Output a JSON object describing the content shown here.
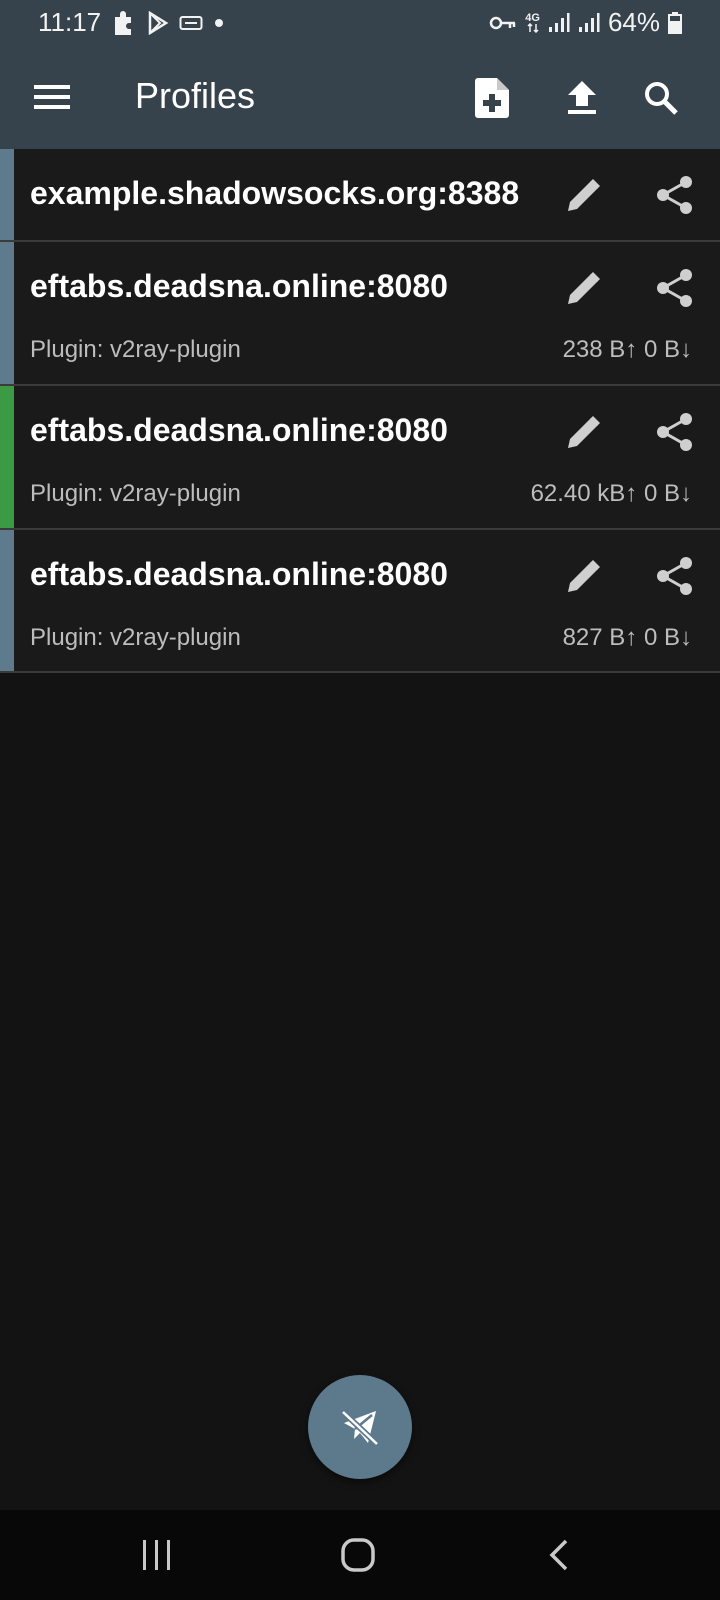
{
  "status_bar": {
    "time": "11:17",
    "network_label_top": "4G",
    "battery": "64%"
  },
  "app_bar": {
    "title": "Profiles",
    "menu_icon": "menu-icon",
    "actions": [
      {
        "name": "add-profile-button",
        "icon": "file-add-icon"
      },
      {
        "name": "import-button",
        "icon": "upload-icon"
      },
      {
        "name": "search-button",
        "icon": "search-icon"
      }
    ]
  },
  "profiles": [
    {
      "name": "example.shadowsocks.org:8388",
      "plugin": "",
      "traffic": "",
      "stripe": "#5e7a8d"
    },
    {
      "name": "eftabs.deadsna.online:8080",
      "plugin": "Plugin: v2ray-plugin",
      "traffic": "238 B↑  0 B↓",
      "stripe": "#5e7a8d"
    },
    {
      "name": "eftabs.deadsna.online:8080",
      "plugin": "Plugin: v2ray-plugin",
      "traffic": "62.40 kB↑  0 B↓",
      "stripe": "#3d9a44"
    },
    {
      "name": "eftabs.deadsna.online:8080",
      "plugin": "Plugin: v2ray-plugin",
      "traffic": "827 B↑  0 B↓",
      "stripe": "#5e7a8d"
    }
  ],
  "fab": {
    "icon": "plane-off-icon"
  },
  "colors": {
    "app_bar": "#37434c",
    "background": "#131313",
    "card": "#1a1a1a",
    "fab": "#5d7a8d",
    "active": "#3d9a44"
  },
  "nav": {
    "recents": "recents-icon",
    "home": "home-icon",
    "back": "back-icon"
  }
}
